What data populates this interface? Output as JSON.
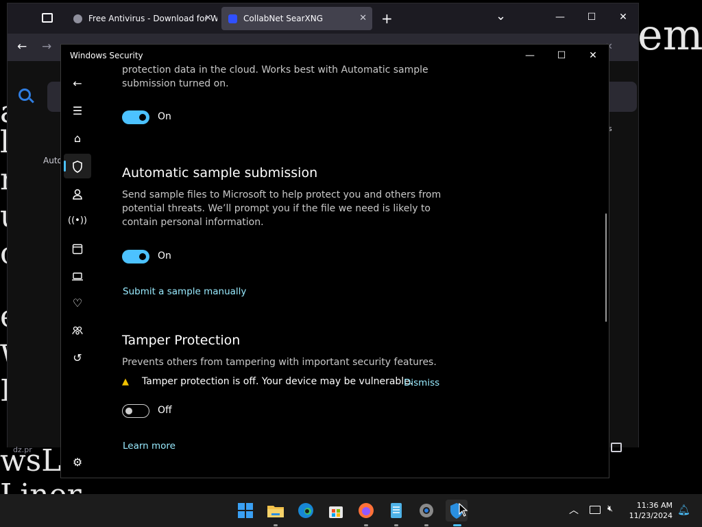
{
  "background": {
    "text_fragments": [
      "ems",
      "a",
      "l",
      "r",
      "u",
      "o",
      "e",
      "W",
      "K",
      "wsLC",
      "Liner"
    ]
  },
  "browser": {
    "tabs": [
      {
        "label": "Free Antivirus - Download for W",
        "active": false
      },
      {
        "label": "CollabNet SearXNG",
        "active": true
      }
    ],
    "new_tab": "+",
    "list_tabs": "⌄",
    "side_texts": {
      "auto": "Auto",
      "dz": "dz.pr",
      "s": "s"
    },
    "colors": {
      "accent": "#2f7de1"
    }
  },
  "ws": {
    "title": "Windows Security",
    "controls": {
      "minimize": "—",
      "maximize": "☐",
      "close": "✕"
    },
    "sidebar_icons": [
      "back-icon",
      "menu-icon",
      "home-icon",
      "shield-icon",
      "account-icon",
      "network-icon",
      "app-browser-icon",
      "device-security-icon",
      "health-icon",
      "family-icon",
      "history-icon",
      "settings-icon"
    ],
    "cloud": {
      "desc_line1": "protection data in the cloud. Works best with Automatic sample",
      "desc_line2": "submission turned on.",
      "toggle_state": "On"
    },
    "sample": {
      "heading": "Automatic sample submission",
      "desc": "Send sample files to Microsoft to help protect you and others from potential threats. We’ll prompt you if the file we need is likely to contain personal information.",
      "toggle_state": "On",
      "submit_link": "Submit a sample manually"
    },
    "tamper": {
      "heading": "Tamper Protection",
      "desc": "Prevents others from tampering with important security features.",
      "warning": "Tamper protection is off. Your device may be vulnerable.",
      "dismiss": "Dismiss",
      "toggle_state": "Off",
      "learn_more": "Learn more"
    },
    "colors": {
      "accent": "#4cc2ff",
      "link": "#99ebff"
    }
  },
  "taskbar": {
    "time": "11:36 AM",
    "date": "11/23/2024",
    "apps": [
      "start-icon",
      "file-explorer-icon",
      "edge-icon",
      "store-icon",
      "firefox-icon",
      "notepad-icon",
      "settings-app-icon",
      "windows-security-icon"
    ]
  }
}
